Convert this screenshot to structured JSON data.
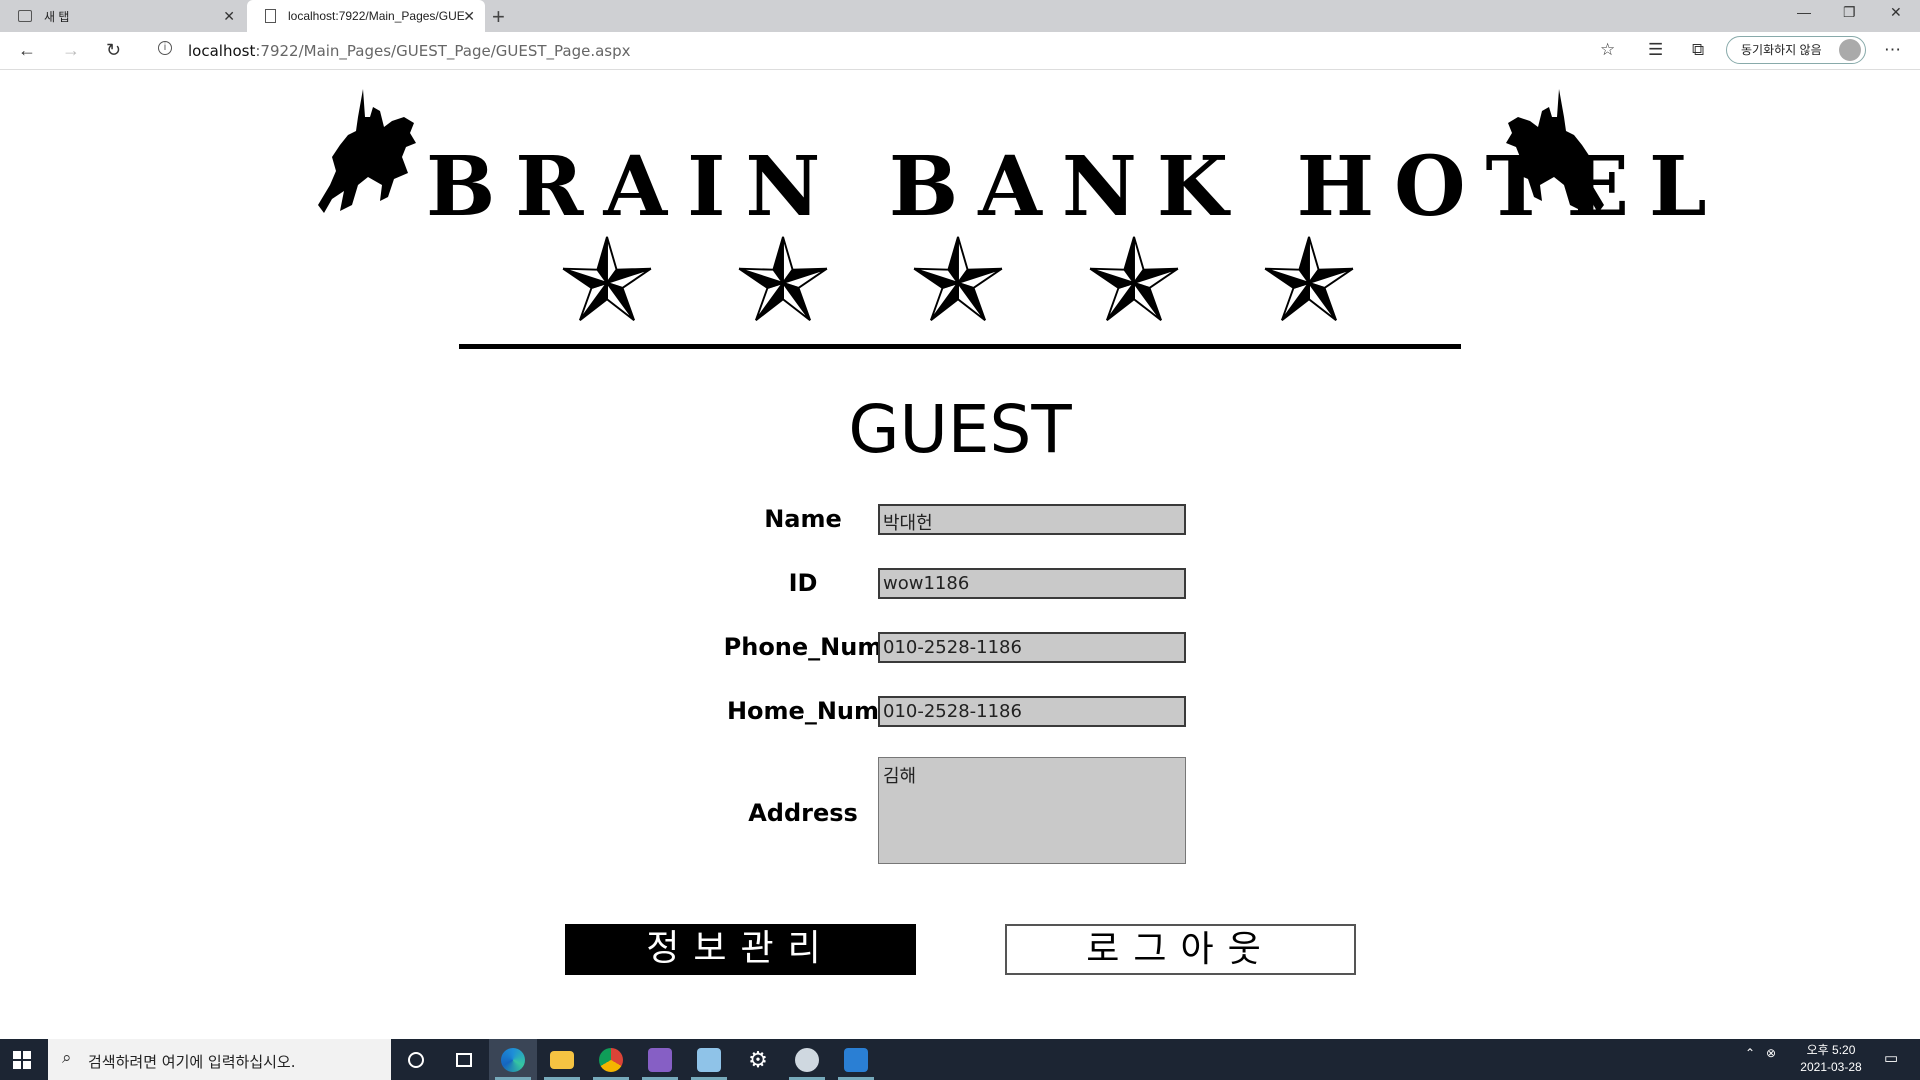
{
  "browser": {
    "tabs": [
      {
        "title": "새 탭"
      },
      {
        "title": "localhost:7922/Main_Pages/GUE"
      }
    ],
    "url_host": "localhost",
    "url_rest": ":7922/Main_Pages/GUEST_Page/GUEST_Page.aspx",
    "sync_label": "동기화하지 않음"
  },
  "logo": {
    "text": "BRAIN BANK HOTEL",
    "star_count": 5
  },
  "page": {
    "title": "GUEST",
    "fields": {
      "name_label": "Name",
      "name_value": "박대헌",
      "id_label": "ID",
      "id_value": "wow1186",
      "phone_label": "Phone_Num",
      "phone_value": "010-2528-1186",
      "home_label": "Home_Num",
      "home_value": "010-2528-1186",
      "address_label": "Address",
      "address_value": "김해"
    },
    "buttons": {
      "info": "정보관리",
      "logout": "로그아웃"
    }
  },
  "taskbar": {
    "search_placeholder": "검색하려면 여기에 입력하십시오.",
    "time": "오후 5:20",
    "date": "2021-03-28",
    "apps": [
      "cortana-icon",
      "task-view-icon",
      "edge-icon",
      "file-explorer-icon",
      "chrome-icon",
      "visual-studio-icon",
      "notepad-icon",
      "settings-icon",
      "paint-icon",
      "photos-icon"
    ]
  },
  "colors": {
    "accent": "#000000",
    "input_bg": "#c9c9c9",
    "taskbar_bg": "#1c2533"
  }
}
